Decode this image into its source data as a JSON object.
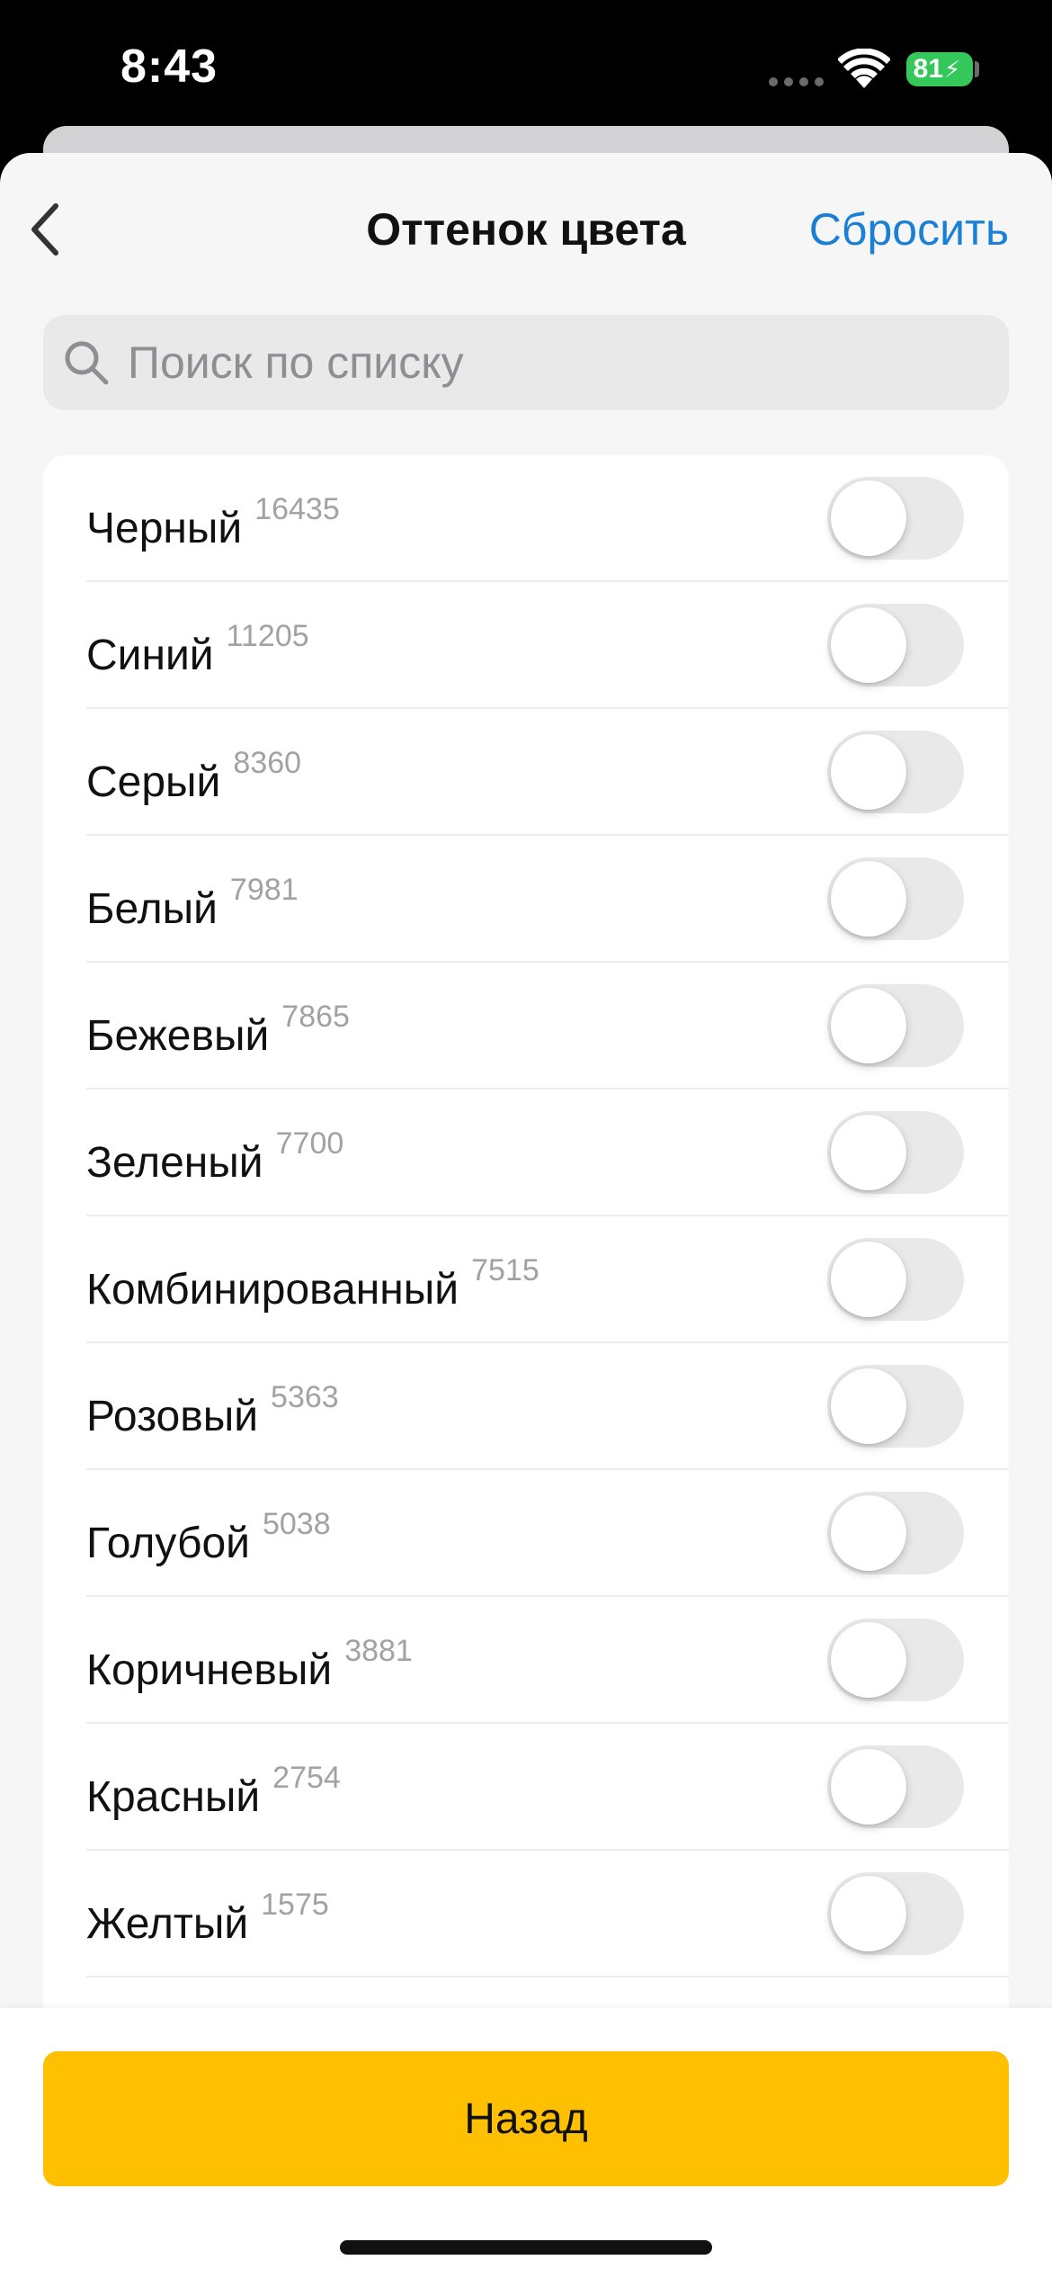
{
  "status_bar": {
    "time": "8:43",
    "battery_level": "81",
    "battery_color": "#34c759",
    "icons": [
      "cellular-signal-icon",
      "wifi-icon",
      "battery-charging-icon"
    ]
  },
  "header": {
    "back_icon": "chevron-left-icon",
    "title": "Оттенок цвета",
    "reset_label": "Сбросить",
    "reset_color": "#1a80d6"
  },
  "search": {
    "icon": "search-icon",
    "placeholder": "Поиск по списку",
    "value": ""
  },
  "colors": {
    "items": [
      {
        "label": "Черный",
        "count": "16435",
        "enabled": false
      },
      {
        "label": "Синий",
        "count": "11205",
        "enabled": false
      },
      {
        "label": "Серый",
        "count": "8360",
        "enabled": false
      },
      {
        "label": "Белый",
        "count": "7981",
        "enabled": false
      },
      {
        "label": "Бежевый",
        "count": "7865",
        "enabled": false
      },
      {
        "label": "Зеленый",
        "count": "7700",
        "enabled": false
      },
      {
        "label": "Комбинированный",
        "count": "7515",
        "enabled": false
      },
      {
        "label": "Розовый",
        "count": "5363",
        "enabled": false
      },
      {
        "label": "Голубой",
        "count": "5038",
        "enabled": false
      },
      {
        "label": "Коричневый",
        "count": "3881",
        "enabled": false
      },
      {
        "label": "Красный",
        "count": "2754",
        "enabled": false
      },
      {
        "label": "Желтый",
        "count": "1575",
        "enabled": false
      }
    ]
  },
  "footer": {
    "back_button_label": "Назад",
    "back_button_color": "#fec000"
  }
}
